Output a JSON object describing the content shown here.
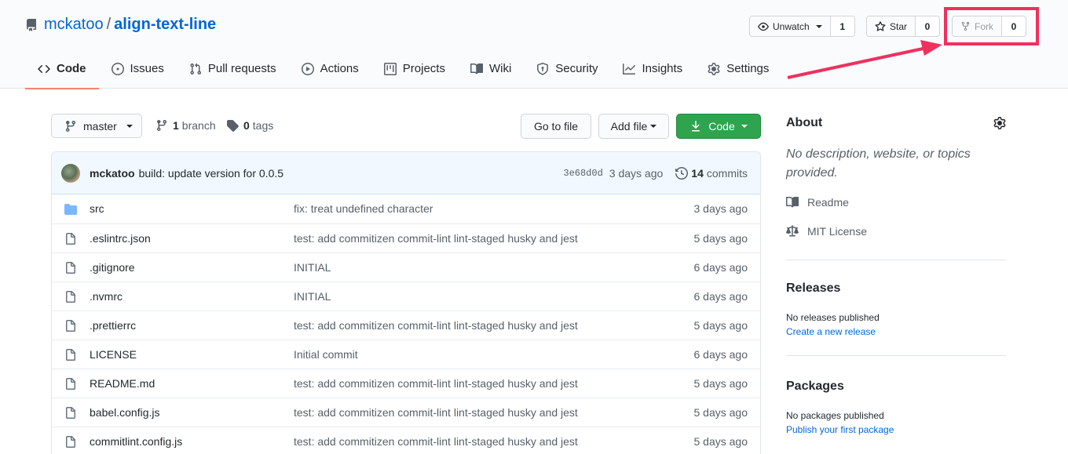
{
  "repo": {
    "owner": "mckatoo",
    "separator": "/",
    "name": "align-text-line"
  },
  "actions": {
    "watch": {
      "label": "Unwatch",
      "count": "1"
    },
    "star": {
      "label": "Star",
      "count": "0"
    },
    "fork": {
      "label": "Fork",
      "count": "0"
    }
  },
  "annotation_color": "#f0305e",
  "tabs": [
    {
      "label": "Code",
      "icon": "code-icon"
    },
    {
      "label": "Issues",
      "icon": "issue-icon"
    },
    {
      "label": "Pull requests",
      "icon": "pull-request-icon"
    },
    {
      "label": "Actions",
      "icon": "play-icon"
    },
    {
      "label": "Projects",
      "icon": "project-icon"
    },
    {
      "label": "Wiki",
      "icon": "book-icon"
    },
    {
      "label": "Security",
      "icon": "shield-icon"
    },
    {
      "label": "Insights",
      "icon": "graph-icon"
    },
    {
      "label": "Settings",
      "icon": "gear-icon"
    }
  ],
  "filenav": {
    "branch": "master",
    "branch_count": "1",
    "branch_label": "branch",
    "tag_count": "0",
    "tag_label": "tags",
    "go_to_file": "Go to file",
    "add_file": "Add file",
    "code": "Code"
  },
  "commit": {
    "author": "mckatoo",
    "message": "build: update version for 0.0.5",
    "sha": "3e68d0d",
    "age": "3 days ago",
    "commit_count": "14",
    "commit_label": "commits"
  },
  "files": [
    {
      "name": "src",
      "type": "folder",
      "message": "fix: treat undefined character",
      "age": "3 days ago"
    },
    {
      "name": ".eslintrc.json",
      "type": "file",
      "message": "test: add commitizen commit-lint lint-staged husky and jest",
      "age": "5 days ago"
    },
    {
      "name": ".gitignore",
      "type": "file",
      "message": "INITIAL",
      "age": "6 days ago"
    },
    {
      "name": ".nvmrc",
      "type": "file",
      "message": "INITIAL",
      "age": "6 days ago"
    },
    {
      "name": ".prettierrc",
      "type": "file",
      "message": "test: add commitizen commit-lint lint-staged husky and jest",
      "age": "5 days ago"
    },
    {
      "name": "LICENSE",
      "type": "file",
      "message": "Initial commit",
      "age": "6 days ago"
    },
    {
      "name": "README.md",
      "type": "file",
      "message": "test: add commitizen commit-lint lint-staged husky and jest",
      "age": "5 days ago"
    },
    {
      "name": "babel.config.js",
      "type": "file",
      "message": "test: add commitizen commit-lint lint-staged husky and jest",
      "age": "5 days ago"
    },
    {
      "name": "commitlint.config.js",
      "type": "file",
      "message": "test: add commitizen commit-lint lint-staged husky and jest",
      "age": "5 days ago"
    }
  ],
  "sidebar": {
    "about_title": "About",
    "about_description": "No description, website, or topics provided.",
    "readme": "Readme",
    "license": "MIT License",
    "releases_title": "Releases",
    "releases_none": "No releases published",
    "releases_create": "Create a new release",
    "packages_title": "Packages",
    "packages_none": "No packages published",
    "packages_publish": "Publish your first package"
  }
}
